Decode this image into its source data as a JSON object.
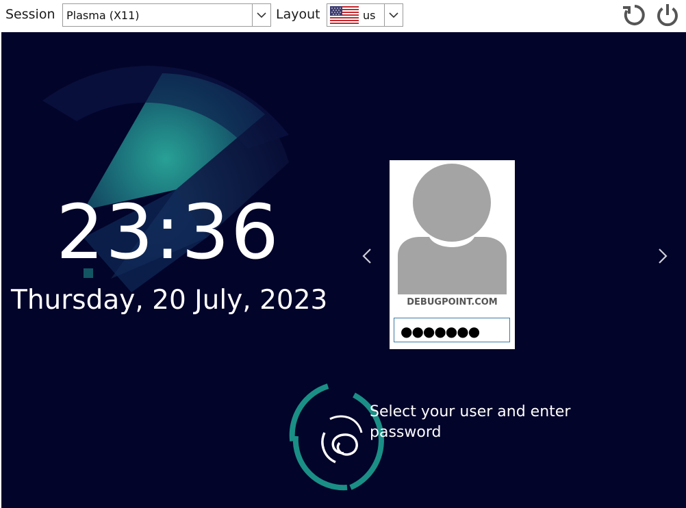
{
  "topbar": {
    "session_label": "Session",
    "session_value": "Plasma (X11)",
    "layout_label": "Layout",
    "layout_value": "us",
    "layout_flag_icon": "us-flag-icon",
    "restart_icon": "restart-icon",
    "shutdown_icon": "power-icon"
  },
  "clock": {
    "time": "23:36",
    "date": "Thursday, 20 July, 2023"
  },
  "user": {
    "name": "DEBUGPOINT.COM",
    "password_mask": "●●●●●●●",
    "avatar_icon": "user-avatar-icon",
    "prev_icon": "chevron-left-icon",
    "next_icon": "chevron-right-icon"
  },
  "hint": {
    "text": "Select your user and enter password"
  },
  "colors": {
    "background": "#03042a",
    "accent_teal": "#1fa99a",
    "avatar_gray": "#a4a4a4",
    "field_border": "#3a7aa6"
  }
}
